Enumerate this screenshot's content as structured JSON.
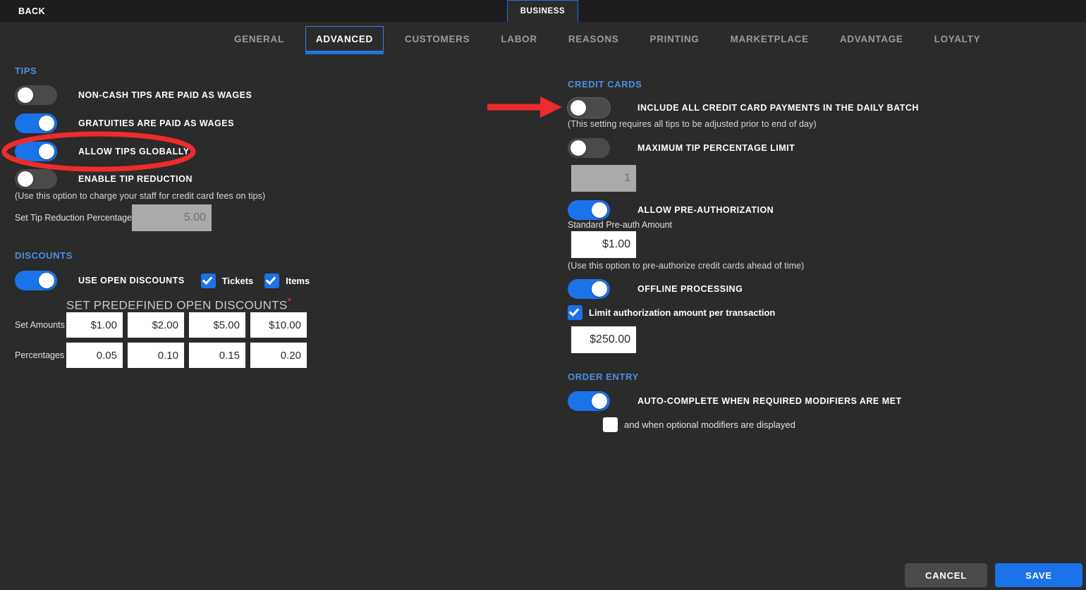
{
  "topbar": {
    "back_label": "BACK",
    "business_tab_label": "BUSINESS"
  },
  "tabs": [
    {
      "label": "GENERAL",
      "active": false
    },
    {
      "label": "ADVANCED",
      "active": true
    },
    {
      "label": "CUSTOMERS",
      "active": false
    },
    {
      "label": "LABOR",
      "active": false
    },
    {
      "label": "REASONS",
      "active": false
    },
    {
      "label": "PRINTING",
      "active": false
    },
    {
      "label": "MARKETPLACE",
      "active": false
    },
    {
      "label": "ADVANTAGE",
      "active": false
    },
    {
      "label": "LOYALTY",
      "active": false
    }
  ],
  "tips": {
    "heading": "TIPS",
    "non_cash_tips_label": "NON-CASH TIPS ARE PAID AS WAGES",
    "non_cash_tips_state": "off",
    "gratuities_label": "GRATUITIES ARE PAID AS WAGES",
    "gratuities_state": "on",
    "allow_tips_globally_label": "ALLOW TIPS GLOBALLY",
    "allow_tips_globally_state": "on",
    "enable_tip_reduction_label": "ENABLE TIP REDUCTION",
    "enable_tip_reduction_state": "off",
    "tip_reduction_hint": "(Use this option to charge your staff for credit card fees on tips)",
    "set_tip_reduction_label": "Set Tip Reduction Percentage",
    "set_tip_reduction_value": "5.00"
  },
  "discounts": {
    "heading": "DISCOUNTS",
    "use_open_discounts_label": "USE OPEN DISCOUNTS",
    "use_open_discounts_state": "on",
    "tickets_label": "Tickets",
    "tickets_checked": true,
    "items_label": "Items",
    "items_checked": true,
    "predefined_heading": "SET PREDEFINED OPEN DISCOUNTS",
    "required_marker": "*",
    "set_amounts_label": "Set Amounts",
    "set_amounts": [
      "$1.00",
      "$2.00",
      "$5.00",
      "$10.00"
    ],
    "percentages_label": "Percentages",
    "percentages": [
      "0.05",
      "0.10",
      "0.15",
      "0.20"
    ]
  },
  "credit_cards": {
    "heading": "CREDIT CARDS",
    "include_all_label": "INCLUDE ALL CREDIT CARD PAYMENTS IN THE DAILY BATCH",
    "include_all_state": "off",
    "include_all_hint": "(This setting requires all tips to be adjusted prior to end of day)",
    "max_tip_pct_label": "MAXIMUM TIP PERCENTAGE LIMIT",
    "max_tip_pct_state": "off",
    "max_tip_pct_value": "1",
    "allow_preauth_label": "ALLOW PRE-AUTHORIZATION",
    "allow_preauth_state": "on",
    "standard_preauth_label": "Standard Pre-auth Amount",
    "standard_preauth_value": "$1.00",
    "preauth_hint": "(Use this option to pre-authorize credit cards ahead of time)",
    "offline_processing_label": "OFFLINE PROCESSING",
    "offline_processing_state": "on",
    "limit_auth_label": "Limit authorization amount per transaction",
    "limit_auth_checked": true,
    "limit_auth_value": "$250.00"
  },
  "order_entry": {
    "heading": "ORDER ENTRY",
    "auto_complete_label": "AUTO-COMPLETE WHEN REQUIRED MODIFIERS ARE MET",
    "auto_complete_state": "on",
    "optional_modifiers_label": "and when optional modifiers are displayed",
    "optional_modifiers_checked": false
  },
  "footer": {
    "cancel_label": "CANCEL",
    "save_label": "SAVE"
  },
  "annotations": {
    "ellipse_target": "ALLOW TIPS GLOBALLY",
    "arrow_target": "INCLUDE ALL CREDIT CARD PAYMENTS IN THE DAILY BATCH",
    "color": "#ee2b2b"
  },
  "colors": {
    "accent_blue": "#1a73e8",
    "section_heading": "#4a90e2",
    "background": "#2b2b2b",
    "topbar": "#1c1c1c",
    "toggle_off": "#4a4a4a"
  }
}
